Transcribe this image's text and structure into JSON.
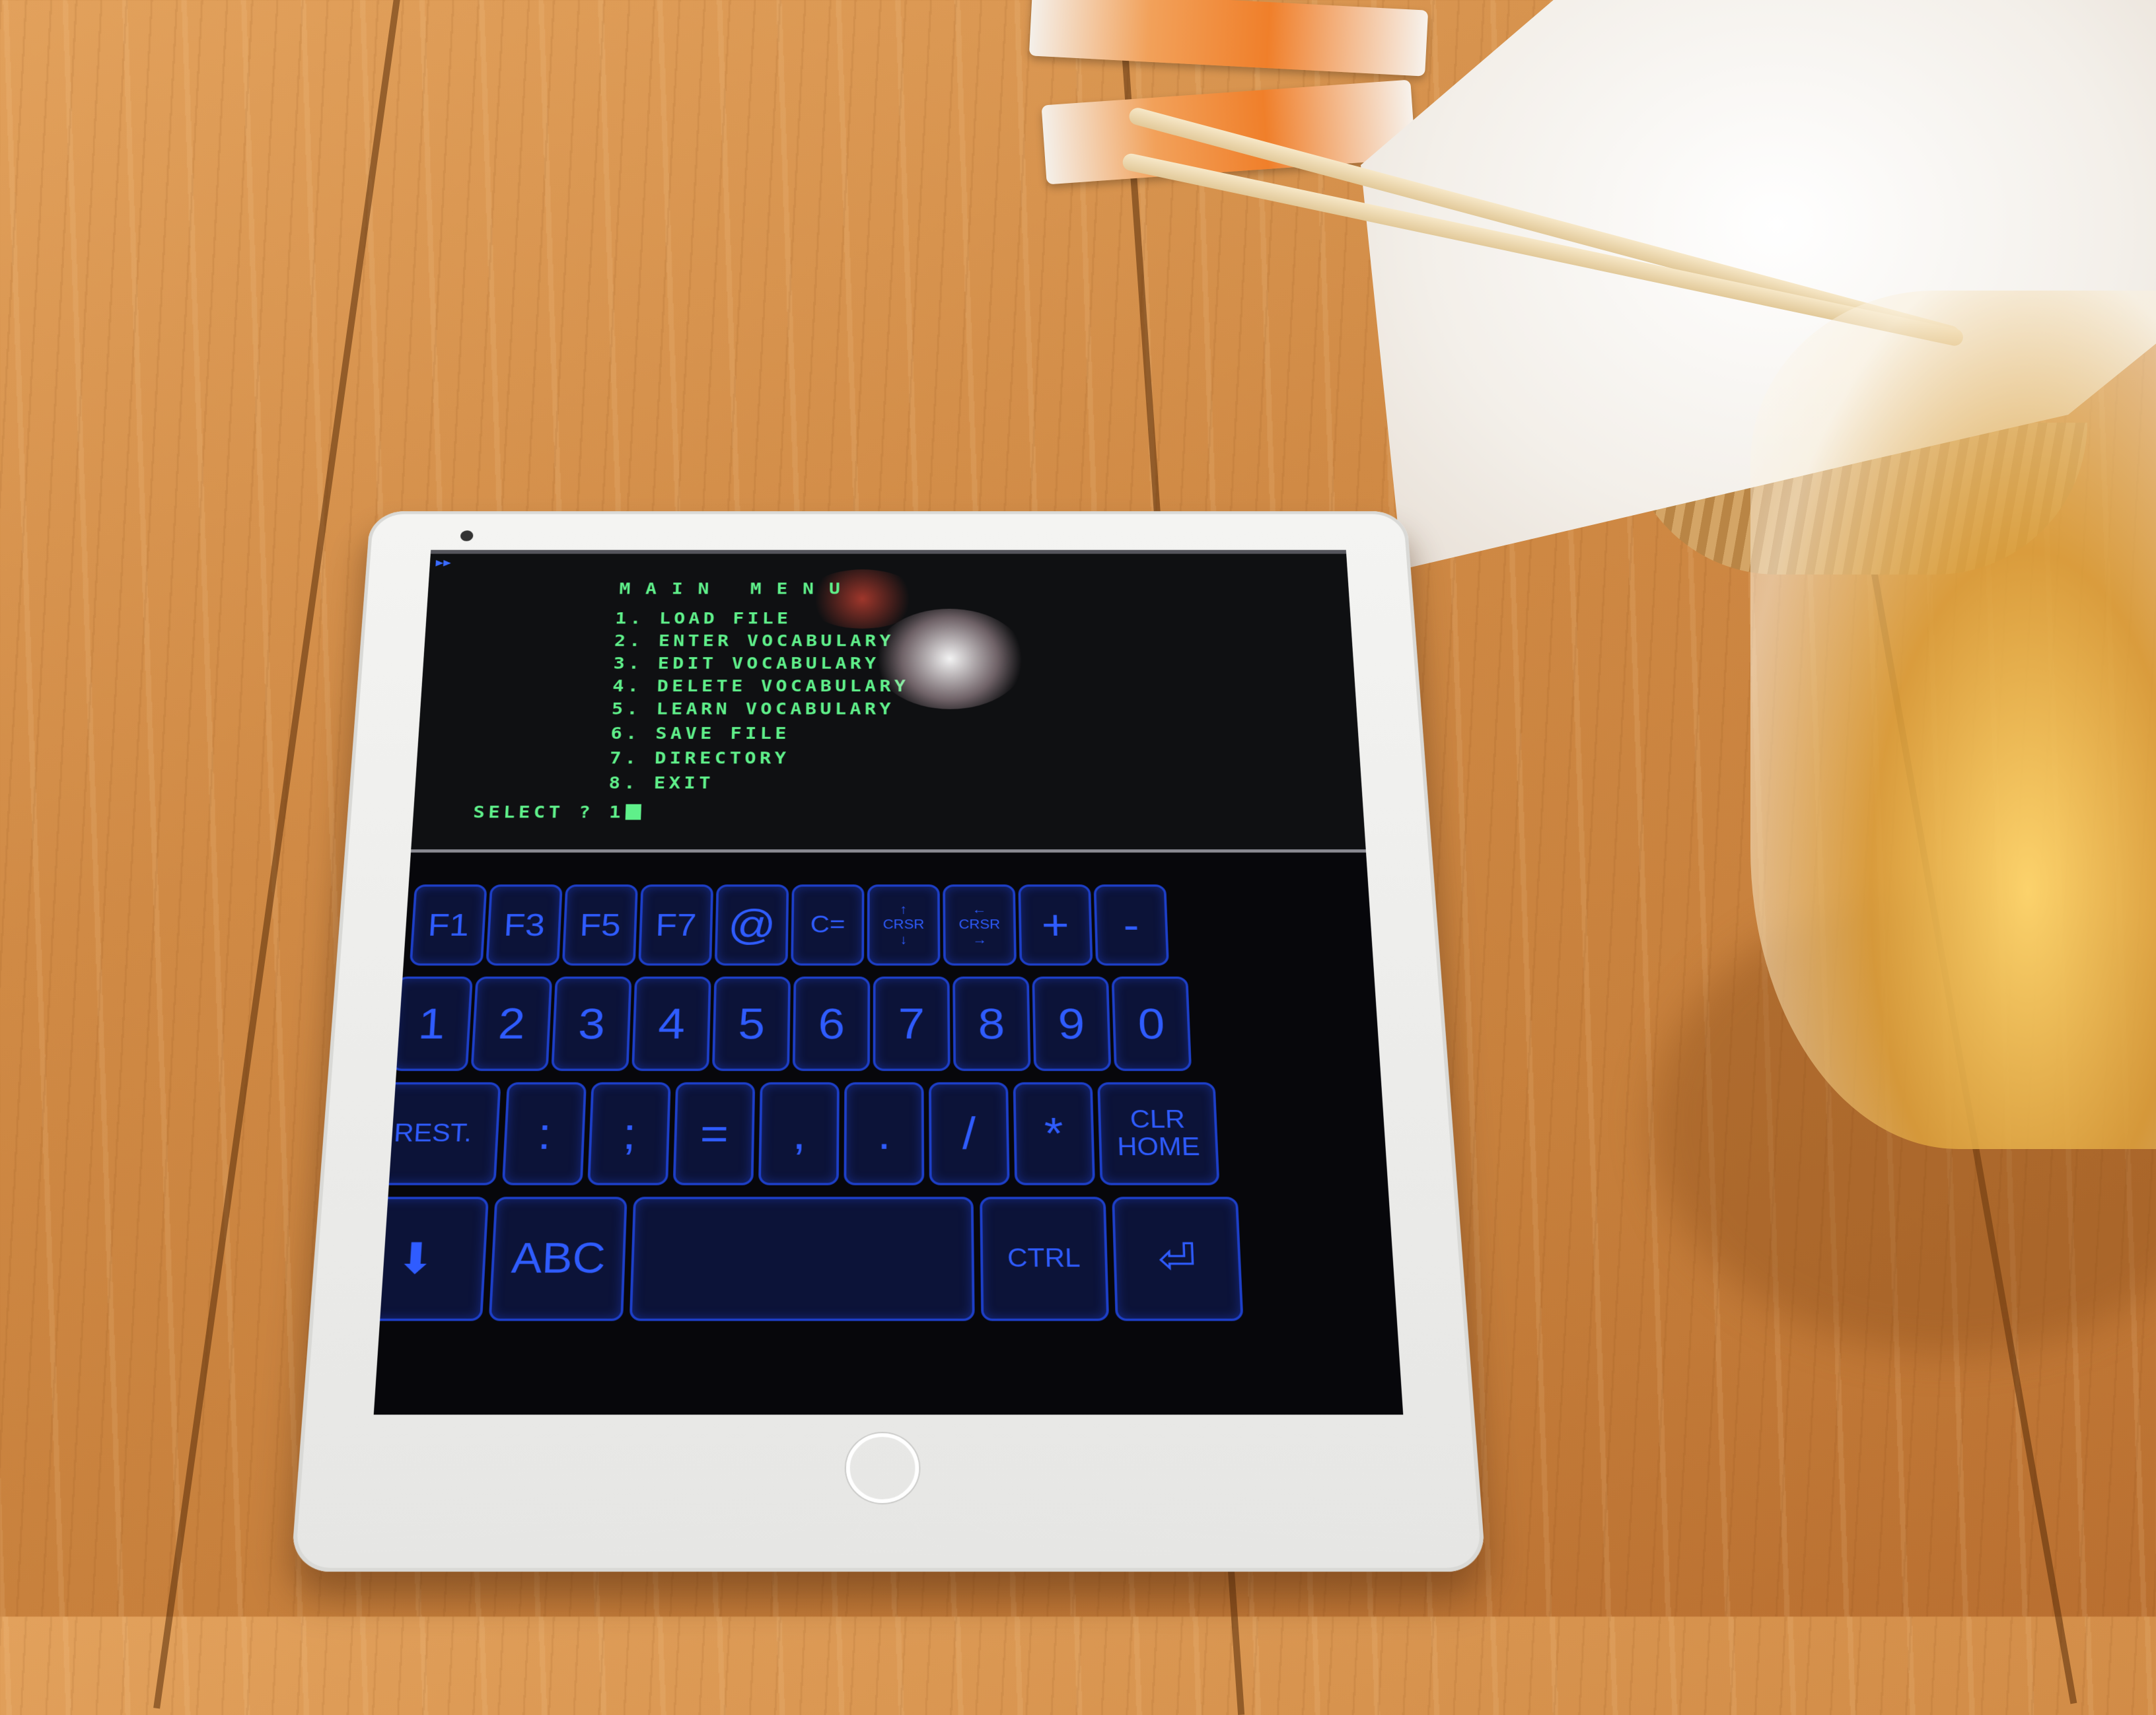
{
  "terminal": {
    "title": "MAIN MENU",
    "menu_items": [
      "1. LOAD FILE",
      "2. ENTER VOCABULARY",
      "3. EDIT VOCABULARY",
      "4. DELETE VOCABULARY",
      "5. LEARN VOCABULARY",
      "6. SAVE FILE",
      "7. DIRECTORY",
      "8. EXIT"
    ],
    "prompt": "SELECT ? 1",
    "indicator": "▶▶",
    "text_color": "#5ff08a"
  },
  "keyboard": {
    "key_color": "#2f5cff",
    "row1": [
      "F1",
      "F3",
      "F5",
      "F7",
      "@",
      "C=",
      "↑\nCRSR\n↓",
      "←\nCRSR\n→",
      "+",
      "-"
    ],
    "row2": [
      "1",
      "2",
      "3",
      "4",
      "5",
      "6",
      "7",
      "8",
      "9",
      "0"
    ],
    "row3": [
      "REST.",
      ":",
      ";",
      "=",
      ",",
      ".",
      "/",
      "*",
      "CLR\nHOME"
    ],
    "row4": [
      "⬇",
      "ABC",
      "",
      "CTRL",
      "⏎"
    ]
  }
}
